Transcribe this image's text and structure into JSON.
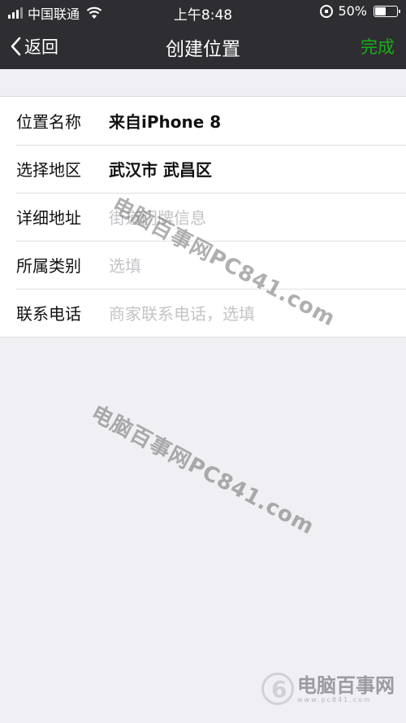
{
  "status_bar": {
    "carrier": "中国联通",
    "time": "上午8:48",
    "battery_text": "50%",
    "battery_level": 0.5
  },
  "nav": {
    "back_label": "返回",
    "title": "创建位置",
    "done_label": "完成",
    "done_color": "#1aad19"
  },
  "form": {
    "rows": [
      {
        "label": "位置名称",
        "value": "来自iPhone 8",
        "placeholder": ""
      },
      {
        "label": "选择地区",
        "value": "武汉市 武昌区",
        "placeholder": ""
      },
      {
        "label": "详细地址",
        "value": "",
        "placeholder": "街道门牌信息"
      },
      {
        "label": "所属类别",
        "value": "",
        "placeholder": "选填"
      },
      {
        "label": "联系电话",
        "value": "",
        "placeholder": "商家联系电话，选填"
      }
    ]
  },
  "watermark": {
    "text": "电脑百事网PC841.com"
  },
  "logo": {
    "name": "电脑百事网",
    "url": "www.pc841.com"
  }
}
